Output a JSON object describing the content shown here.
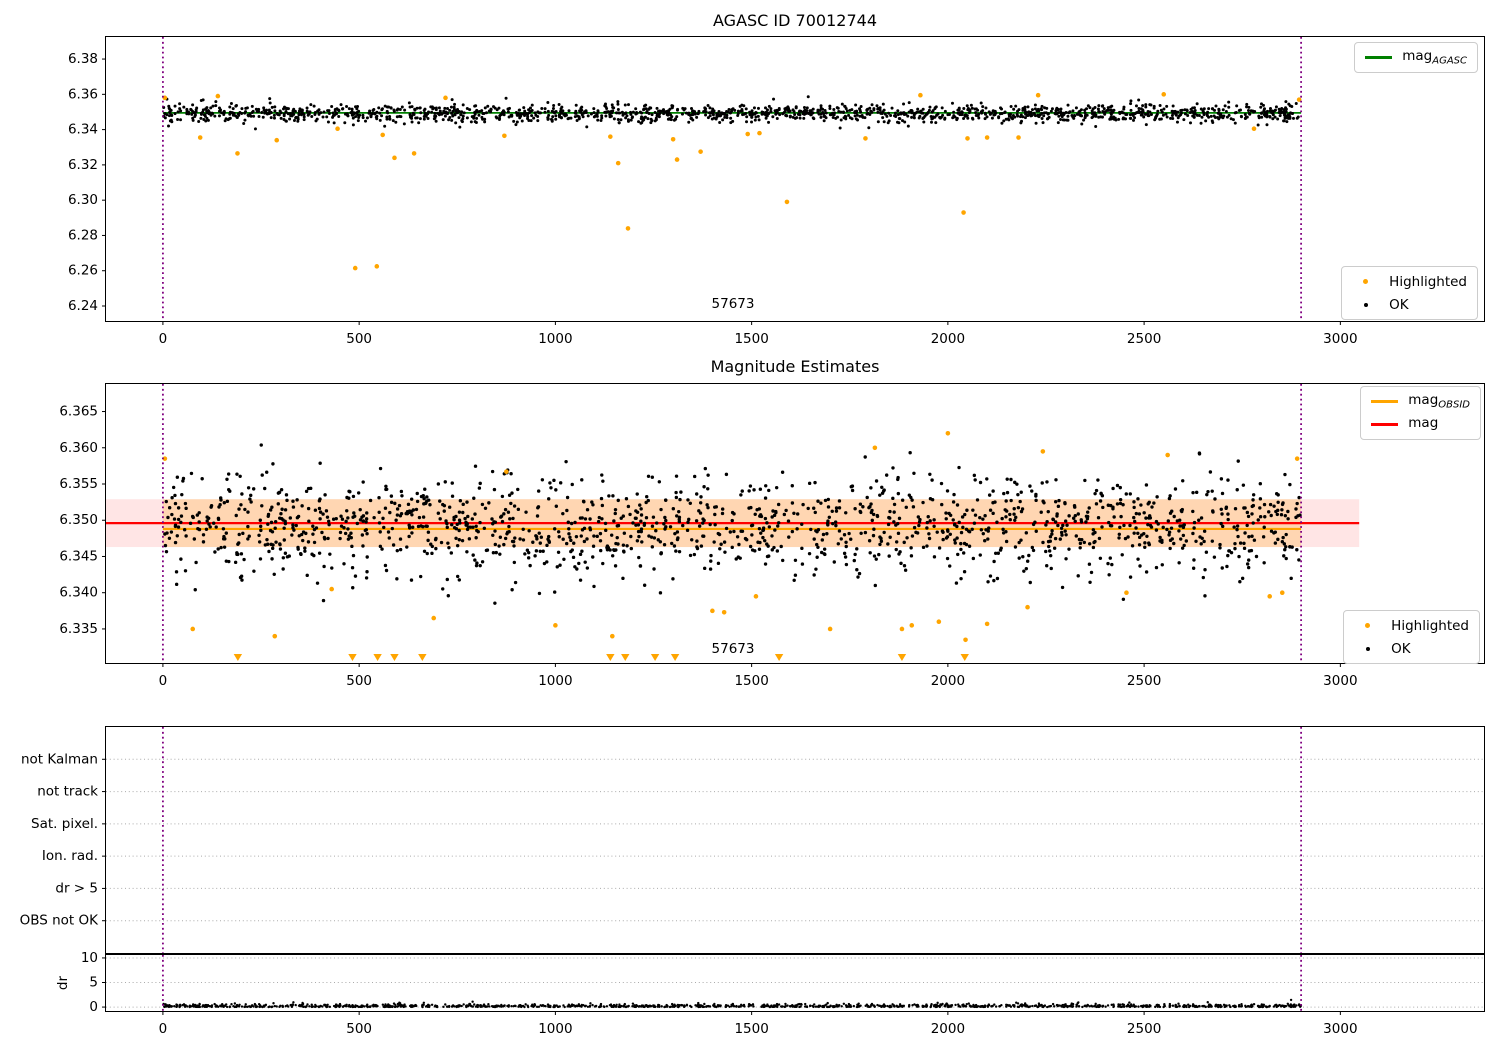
{
  "figure": {
    "background": "#ffffff"
  },
  "colors": {
    "highlight": "#FFA500",
    "ok": "#000000",
    "mag_agasc": "#008000",
    "mag": "#FF0000",
    "mag_obsid": "#FFA500",
    "obsid_vline": "#800080",
    "band": "rgba(255,0,0,0.10)",
    "band_obsid": "rgba(255,165,0,0.22)",
    "grid": "#ababab"
  },
  "chart_data": [
    {
      "type": "scatter",
      "title": "AGASC ID 70012744",
      "obsid_label": "57673",
      "xlim": [
        -145,
        3366
      ],
      "ylim": [
        6.2315,
        6.3925
      ],
      "xticks": [
        0,
        500,
        1000,
        1500,
        2000,
        2500,
        3000
      ],
      "yticks": [
        6.24,
        6.26,
        6.28,
        6.3,
        6.32,
        6.34,
        6.36,
        6.38
      ],
      "ytick_labels": [
        "6.24",
        "6.26",
        "6.28",
        "6.30",
        "6.32",
        "6.34",
        "6.36",
        "6.38"
      ],
      "obsid_vlines": [
        0,
        2900
      ],
      "agasc_mag_line": {
        "y": 6.3495,
        "x0": 0,
        "x1": 2900
      },
      "ok_scatter": {
        "n": 1650,
        "x0": 0,
        "x1": 2900,
        "mean": 6.3492,
        "sigma": 0.0026,
        "clip": 0.0095,
        "seed": 20177
      },
      "highlighted": [
        [
          5,
          6.358
        ],
        [
          95,
          6.3355
        ],
        [
          140,
          6.359
        ],
        [
          190,
          6.3265
        ],
        [
          290,
          6.334
        ],
        [
          445,
          6.3405
        ],
        [
          490,
          6.2615
        ],
        [
          545,
          6.2625
        ],
        [
          560,
          6.337
        ],
        [
          590,
          6.324
        ],
        [
          640,
          6.3265
        ],
        [
          720,
          6.358
        ],
        [
          870,
          6.3365
        ],
        [
          1140,
          6.336
        ],
        [
          1160,
          6.321
        ],
        [
          1185,
          6.284
        ],
        [
          1300,
          6.3345
        ],
        [
          1310,
          6.323
        ],
        [
          1370,
          6.3275
        ],
        [
          1490,
          6.3375
        ],
        [
          1520,
          6.338
        ],
        [
          1590,
          6.299
        ],
        [
          1790,
          6.335
        ],
        [
          1930,
          6.3595
        ],
        [
          2040,
          6.293
        ],
        [
          2050,
          6.335
        ],
        [
          2100,
          6.3355
        ],
        [
          2180,
          6.3355
        ],
        [
          2230,
          6.3595
        ],
        [
          2550,
          6.36
        ],
        [
          2780,
          6.3405
        ],
        [
          2895,
          6.357
        ]
      ],
      "legend_top": {
        "series": [
          {
            "label_prefix": "mag",
            "label_sub": "AGASC",
            "color": "#008000"
          }
        ]
      },
      "legend_bottom": {
        "items": [
          {
            "label": "Highlighted",
            "color": "#FFA500"
          },
          {
            "label": "OK",
            "color": "#000000"
          }
        ]
      }
    },
    {
      "type": "scatter",
      "title": "Magnitude Estimates",
      "obsid_label": "57673",
      "xlim": [
        -145,
        3366
      ],
      "ylim": [
        6.3303,
        6.3688
      ],
      "xticks": [
        0,
        500,
        1000,
        1500,
        2000,
        2500,
        3000
      ],
      "yticks": [
        6.335,
        6.34,
        6.345,
        6.35,
        6.355,
        6.36,
        6.365
      ],
      "ytick_labels": [
        "6.335",
        "6.340",
        "6.345",
        "6.350",
        "6.355",
        "6.360",
        "6.365"
      ],
      "obsid_vlines": [
        0,
        2900
      ],
      "band": {
        "x0": -145,
        "x1": 3048,
        "y0": 6.3463,
        "y1": 6.3529
      },
      "band_obsid": {
        "x0": 0,
        "x1": 2900,
        "y0": 6.3463,
        "y1": 6.3529
      },
      "mag_line": {
        "y": 6.3496,
        "x0": -145,
        "x1": 3048
      },
      "mag_obsid_line": {
        "y": 6.3488,
        "x0": 0,
        "x1": 2900
      },
      "ok_scatter": {
        "n": 1500,
        "x0": 0,
        "x1": 2900,
        "mean": 6.3493,
        "sigma": 0.0036,
        "clip": 0.0115,
        "seed": 7331
      },
      "highlighted": [
        [
          5,
          6.3585
        ],
        [
          76,
          6.335
        ],
        [
          285,
          6.334
        ],
        [
          430,
          6.3405
        ],
        [
          690,
          6.3365
        ],
        [
          875,
          6.3567
        ],
        [
          1000,
          6.3355
        ],
        [
          1145,
          6.334
        ],
        [
          1400,
          6.3375
        ],
        [
          1430,
          6.3373
        ],
        [
          1511,
          6.3395
        ],
        [
          1700,
          6.335
        ],
        [
          1814,
          6.36
        ],
        [
          1883,
          6.335
        ],
        [
          1908,
          6.3355
        ],
        [
          1977,
          6.336
        ],
        [
          2000,
          6.362
        ],
        [
          2045,
          6.3335
        ],
        [
          2100,
          6.3357
        ],
        [
          2203,
          6.338
        ],
        [
          2242,
          6.3595
        ],
        [
          2455,
          6.34
        ],
        [
          2560,
          6.359
        ],
        [
          2820,
          6.3395
        ],
        [
          2852,
          6.34
        ],
        [
          2890,
          6.3585
        ]
      ],
      "clipped_triangles_x": [
        191,
        483,
        547,
        590,
        661,
        1140,
        1178,
        1254,
        1305,
        1570,
        1883,
        2043
      ],
      "legend_top": {
        "series": [
          {
            "label_prefix": "mag",
            "label_sub": "OBSID",
            "color": "#FFA500"
          },
          {
            "label_prefix": "mag",
            "label_sub": "",
            "color": "#FF0000"
          }
        ]
      },
      "legend_bottom": {
        "items": [
          {
            "label": "Highlighted",
            "color": "#FFA500"
          },
          {
            "label": "OK",
            "color": "#000000"
          }
        ]
      }
    },
    {
      "type": "flags",
      "categories": [
        "not Kalman",
        "not track",
        "Sat. pixel.",
        "Ion. rad.",
        "dr > 5",
        "OBS not OK"
      ],
      "xlim": [
        -145,
        3366
      ],
      "obsid_vlines": [
        0,
        2900
      ]
    },
    {
      "type": "scatter",
      "ylabel": "dr",
      "xlim": [
        -145,
        3366
      ],
      "ylim": [
        -0.8,
        10.6
      ],
      "xticks": [
        0,
        500,
        1000,
        1500,
        2000,
        2500,
        3000
      ],
      "yticks": [
        0,
        5,
        10
      ],
      "ytick_labels": [
        "0",
        "5",
        "10"
      ],
      "obsid_vlines": [
        0,
        2900
      ],
      "dr_scatter": {
        "n": 1300,
        "x0": 0,
        "x1": 2900,
        "scale": 0.28,
        "seed": 911
      }
    }
  ]
}
